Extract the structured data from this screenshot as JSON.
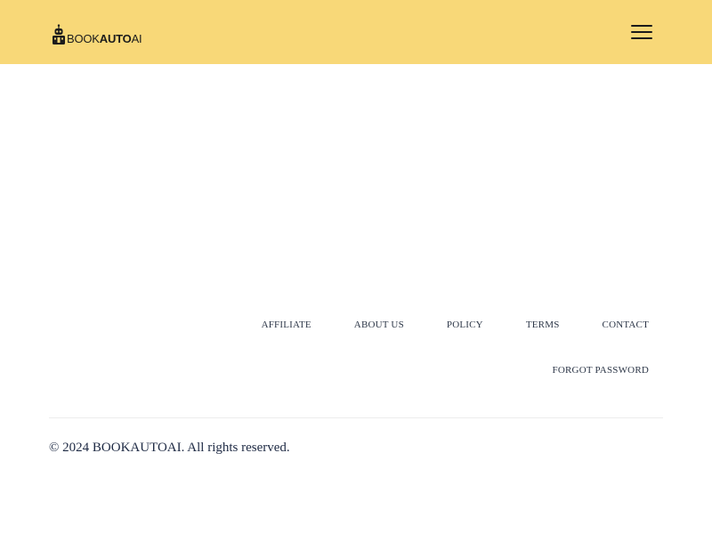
{
  "header": {
    "logo_text_part1": "BOOK",
    "logo_text_part2": "AUTO",
    "logo_text_part3": "AI",
    "background_color": "#f8d878",
    "menu_icon": "hamburger-menu-icon"
  },
  "footer": {
    "links_row1": [
      "AFFILIATE",
      "ABOUT US",
      "POLICY",
      "TERMS",
      "CONTACT"
    ],
    "links_row2": [
      "FORGOT PASSWORD"
    ],
    "copyright": "© 2024 BOOKAUTOAI. All rights reserved."
  }
}
